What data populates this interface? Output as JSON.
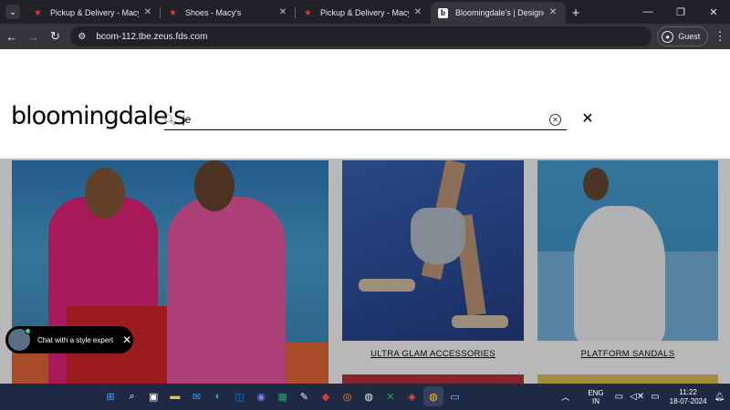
{
  "browser": {
    "tabs": [
      {
        "title": "Pickup & Delivery - Macy's",
        "icon": "macys-star-icon",
        "active": false
      },
      {
        "title": "Shoes - Macy's",
        "icon": "macys-star-icon",
        "active": false
      },
      {
        "title": "Pickup & Delivery - Macy's",
        "icon": "macys-star-icon",
        "active": false
      },
      {
        "title": "Bloomingdale's | Designer Clot",
        "icon": "bloomingdales-b-icon",
        "active": true
      }
    ],
    "favicon_letter": "b",
    "close_glyph": "✕",
    "new_tab_glyph": "+",
    "url": "bcom-112.tbe.zeus.fds.com",
    "profile_label": "Guest"
  },
  "site": {
    "logo_text": "bloomingdale's",
    "search": {
      "value": "je",
      "placeholder": ""
    }
  },
  "tiles": [
    {
      "caption": ""
    },
    {
      "caption": "ULTRA GLAM ACCESSORIES"
    },
    {
      "caption": "PLATFORM SANDALS"
    }
  ],
  "chat": {
    "label": "Chat with a style expert"
  },
  "taskbar": {
    "apps": [
      "windows-start-icon",
      "search-icon",
      "task-view-icon",
      "file-explorer-icon",
      "mail-icon",
      "edge-icon",
      "outlook-icon",
      "teams-icon",
      "excel-check-icon",
      "notepad-icon",
      "red-app-icon",
      "safari-icon",
      "chrome-icon",
      "excel-icon",
      "git-icon",
      "chrome-active-icon",
      "presentation-icon"
    ],
    "lang_line1": "ENG",
    "lang_line2": "IN",
    "time": "11:22",
    "date": "18-07-2024"
  },
  "colors": {
    "tabstrip": "#202124",
    "toolbar": "#35363a",
    "taskbar": "#1e2a44",
    "macys_red": "#e0383e"
  }
}
